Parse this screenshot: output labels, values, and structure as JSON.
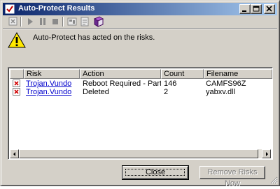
{
  "window": {
    "title": "Auto-Protect Results"
  },
  "toolbar": {
    "icons": [
      "remove-icon",
      "play-icon",
      "pause-icon",
      "stop-icon",
      "properties-icon",
      "export-icon",
      "help-book-icon"
    ]
  },
  "message": {
    "text": "Auto-Protect has acted on the risks."
  },
  "table": {
    "columns": [
      "Risk",
      "Action",
      "Count",
      "Filename"
    ],
    "rows": [
      {
        "risk": "Trojan.Vundo",
        "action": "Reboot Required - Partial",
        "count": "146",
        "filename": "CAMFS96Z"
      },
      {
        "risk": "Trojan.Vundo",
        "action": "Deleted",
        "count": "2",
        "filename": "yabxv.dll"
      }
    ]
  },
  "buttons": {
    "close": "Close",
    "remove": "Remove Risks Now"
  },
  "colors": {
    "titlebar_start": "#0a246a",
    "titlebar_end": "#a6caf0",
    "face": "#d4d0c8",
    "link": "#0000cc"
  }
}
